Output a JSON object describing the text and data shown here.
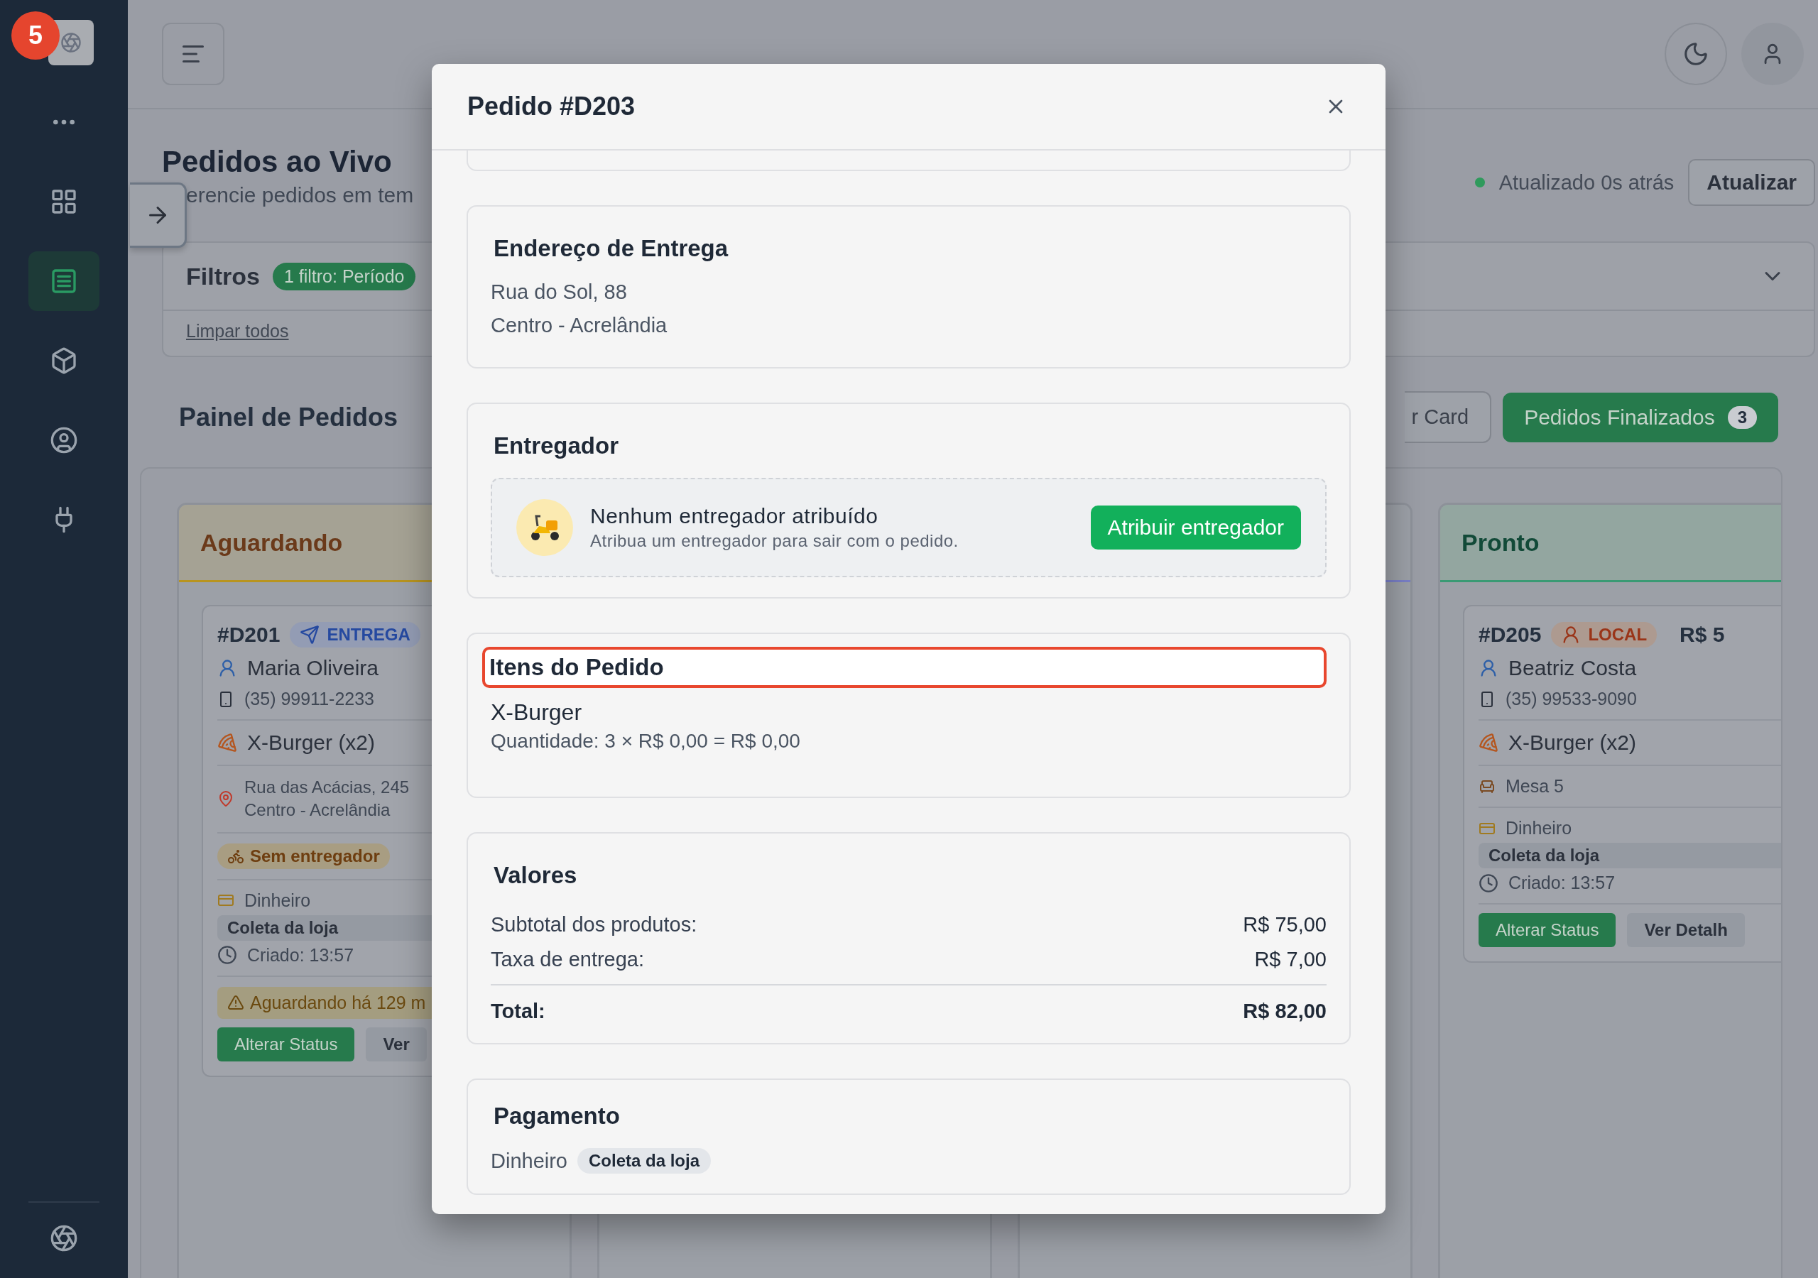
{
  "sidebar": {
    "badge": "5",
    "items": [
      {
        "kind": "more",
        "selected": false
      },
      {
        "kind": "grid",
        "selected": false
      },
      {
        "kind": "orders",
        "selected": true
      },
      {
        "kind": "box",
        "selected": false
      },
      {
        "kind": "user",
        "selected": false
      },
      {
        "kind": "plug",
        "selected": false
      }
    ]
  },
  "page": {
    "title": "Pedidos ao Vivo",
    "subtitle": "erencie pedidos em tem",
    "updated": "Atualizado 0s atrás",
    "refresh": "Atualizar"
  },
  "filters": {
    "title": "Filtros",
    "badge": "1 filtro: Período",
    "clear": "Limpar todos"
  },
  "board": {
    "title": "Painel de Pedidos",
    "partial_button": "r Card",
    "finished_button": "Pedidos Finalizados",
    "finished_count": "3",
    "columns": [
      {
        "title": "Aguardando",
        "color": "#b8941f",
        "cards": [
          {
            "id": "#D201",
            "badge": {
              "kind": "entrega",
              "label": "ENTREGA"
            },
            "customer": "Maria Oliveira",
            "phone": "(35) 99911-2233",
            "item": "X-Burger (x2)",
            "address": [
              "Rua das Acácias, 245",
              "Centro - Acrelândia"
            ],
            "courier": "Sem entregador",
            "payment": "Dinheiro",
            "pickup": "Coleta da loja",
            "created": "Criado: 13:57",
            "alert": "Aguardando há 129 m",
            "buttons": [
              "Alterar Status",
              "Ver"
            ]
          }
        ]
      },
      {},
      {
        "color": "#7a80c8"
      },
      {
        "title": "Pronto",
        "color": "#3a9a74",
        "cards": [
          {
            "id": "#D205",
            "badge": {
              "kind": "local",
              "label": "LOCAL"
            },
            "price": "R$ 5",
            "customer": "Beatriz Costa",
            "phone": "(35) 99533-9090",
            "item": "X-Burger (x2)",
            "table": "Mesa 5",
            "payment": "Dinheiro",
            "pickup": "Coleta da loja",
            "created": "Criado: 13:57",
            "buttons": [
              "Alterar Status",
              "Ver Detalh"
            ]
          }
        ]
      }
    ]
  },
  "modal": {
    "title": "Pedido #D203",
    "address": {
      "title": "Endereço de Entrega",
      "lines": [
        "Rua do Sol, 88",
        "Centro - Acrelândia"
      ]
    },
    "courier": {
      "title": "Entregador",
      "empty_title": "Nenhum entregador atribuído",
      "empty_text": "Atribua um entregador para sair com o pedido.",
      "button": "Atribuir entregador"
    },
    "items": {
      "title": "Itens do Pedido",
      "highlighted": true,
      "list": [
        {
          "name": "X-Burger",
          "detail": "Quantidade: 3 × R$ 0,00 = R$ 0,00"
        }
      ]
    },
    "values": {
      "title": "Valores",
      "rows": [
        {
          "label": "Subtotal dos produtos:",
          "value": "R$ 75,00",
          "total": false
        },
        {
          "label": "Taxa de entrega:",
          "value": "R$ 7,00",
          "total": false
        },
        {
          "label": "Total:",
          "value": "R$ 82,00",
          "total": true
        }
      ]
    },
    "payment": {
      "title": "Pagamento",
      "method": "Dinheiro",
      "tag": "Coleta da loja"
    }
  }
}
